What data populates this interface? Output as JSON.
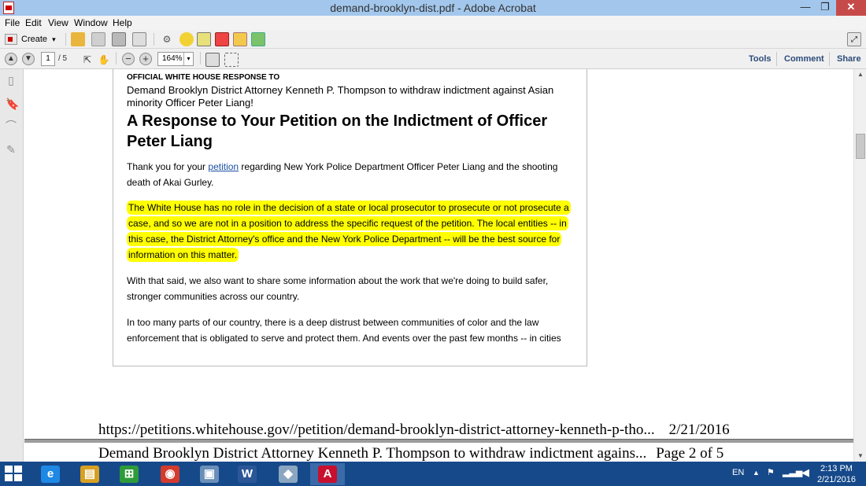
{
  "window": {
    "title": "demand-brooklyn-dist.pdf - Adobe Acrobat",
    "min_glyph": "—",
    "max_glyph": "❐",
    "close_glyph": "✕"
  },
  "menu": {
    "items": [
      "File",
      "Edit",
      "View",
      "Window",
      "Help"
    ]
  },
  "toolbar": {
    "create_label": "Create",
    "create_caret": "▾"
  },
  "nav": {
    "page_current": "1",
    "page_total": "/ 5",
    "zoom": "164%",
    "zoom_caret": "▾",
    "links": [
      "Tools",
      "Comment",
      "Share"
    ]
  },
  "document": {
    "small_heading": "OFFICIAL WHITE HOUSE RESPONSE TO",
    "petition_title": "Demand Brooklyn District Attorney Kenneth P. Thompson to withdraw indictment against Asian minority Officer Peter Liang!",
    "headline": "A Response to Your Petition on the Indictment of Officer Peter Liang",
    "para1_before": "Thank you for your ",
    "para1_link": "petition",
    "para1_after": " regarding New York Police Department Officer Peter Liang and the shooting death of Akai Gurley.",
    "para2_highlighted": "The White House has no role in the decision of a state or local prosecutor to prosecute or not prosecute a case, and so we are not in a position to address the specific request of the petition. The local entities -- in this case, the District Attorney's office and the New York Police Department -- will be the best source for information on this matter.",
    "para3": "With that said, we also want to share some information about the work that we're doing to build safer, stronger communities across our country.",
    "para4": "In too many parts of our country, there is a deep distrust between communities of color and the law enforcement that is obligated to serve and protect them. And events over the past few months -- in cities",
    "footer_url": "https://petitions.whitehouse.gov//petition/demand-brooklyn-district-attorney-kenneth-p-tho...",
    "footer_date": "2/21/2016",
    "next_page_header": "Demand Brooklyn District Attorney Kenneth P. Thompson to withdraw indictment agains...",
    "next_page_number": "Page 2 of 5",
    "highlight_color": "#ffff00"
  },
  "taskbar": {
    "apps": [
      {
        "icon": "internet-explorer-icon",
        "glyph": "e",
        "color": "#1e88e5"
      },
      {
        "icon": "file-explorer-icon",
        "glyph": "▤",
        "color": "#d8a020"
      },
      {
        "icon": "store-icon",
        "glyph": "⊞",
        "color": "#2e9b3a"
      },
      {
        "icon": "chrome-icon",
        "glyph": "◉",
        "color": "#d33b2c"
      },
      {
        "icon": "network-folder-icon",
        "glyph": "▣",
        "color": "#6a8fb8"
      },
      {
        "icon": "word-icon",
        "glyph": "W",
        "color": "#2b5797"
      },
      {
        "icon": "generic-app-icon",
        "glyph": "◆",
        "color": "#8aa6c1"
      },
      {
        "icon": "acrobat-icon",
        "glyph": "A",
        "color": "#c8102e"
      }
    ],
    "language": "EN",
    "time": "2:13 PM",
    "date": "2/21/2016"
  }
}
